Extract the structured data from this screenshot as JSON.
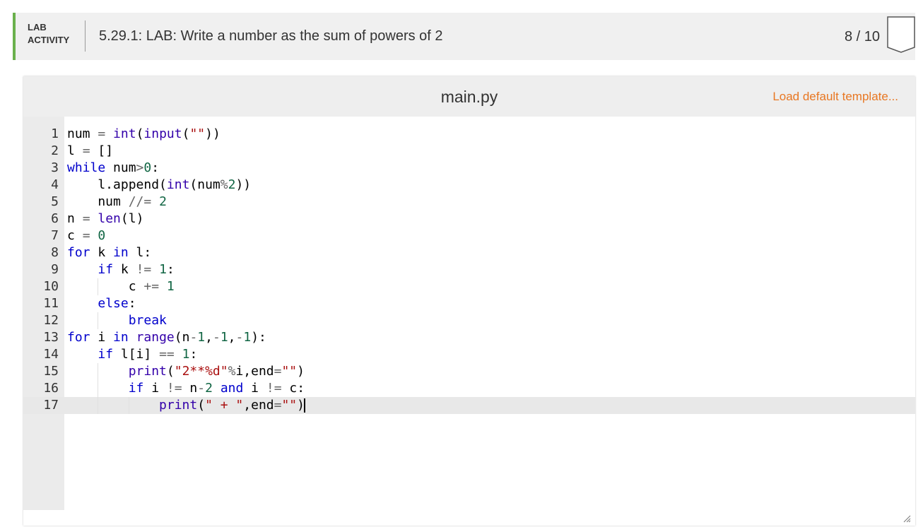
{
  "header": {
    "tag_line1": "LAB",
    "tag_line2": "ACTIVITY",
    "title": "5.29.1: LAB: Write a number as the sum of powers of 2",
    "score": "8 / 10"
  },
  "editor": {
    "file_name": "main.py",
    "load_template_label": "Load default template...",
    "lines": [
      {
        "n": "1",
        "code": "num = int(input(\"\"))"
      },
      {
        "n": "2",
        "code": "l = []"
      },
      {
        "n": "3",
        "code": "while num>0:"
      },
      {
        "n": "4",
        "code": "    l.append(int(num%2))"
      },
      {
        "n": "5",
        "code": "    num //= 2"
      },
      {
        "n": "6",
        "code": "n = len(l)"
      },
      {
        "n": "7",
        "code": "c = 0"
      },
      {
        "n": "8",
        "code": "for k in l:"
      },
      {
        "n": "9",
        "code": "    if k != 1:"
      },
      {
        "n": "10",
        "code": "        c += 1"
      },
      {
        "n": "11",
        "code": "    else:"
      },
      {
        "n": "12",
        "code": "        break"
      },
      {
        "n": "13",
        "code": "for i in range(n-1,-1,-1):"
      },
      {
        "n": "14",
        "code": "    if l[i] == 1:"
      },
      {
        "n": "15",
        "code": "        print(\"2**%d\"%i,end=\"\")"
      },
      {
        "n": "16",
        "code": "        if i != n-2 and i != c:"
      },
      {
        "n": "17",
        "code": "            print(\" + \",end=\"\")"
      }
    ],
    "active_line": "17"
  },
  "colors": {
    "accent_green": "#6ab04c",
    "link_orange": "#e87722",
    "keyword_blue": "#0000cc"
  }
}
